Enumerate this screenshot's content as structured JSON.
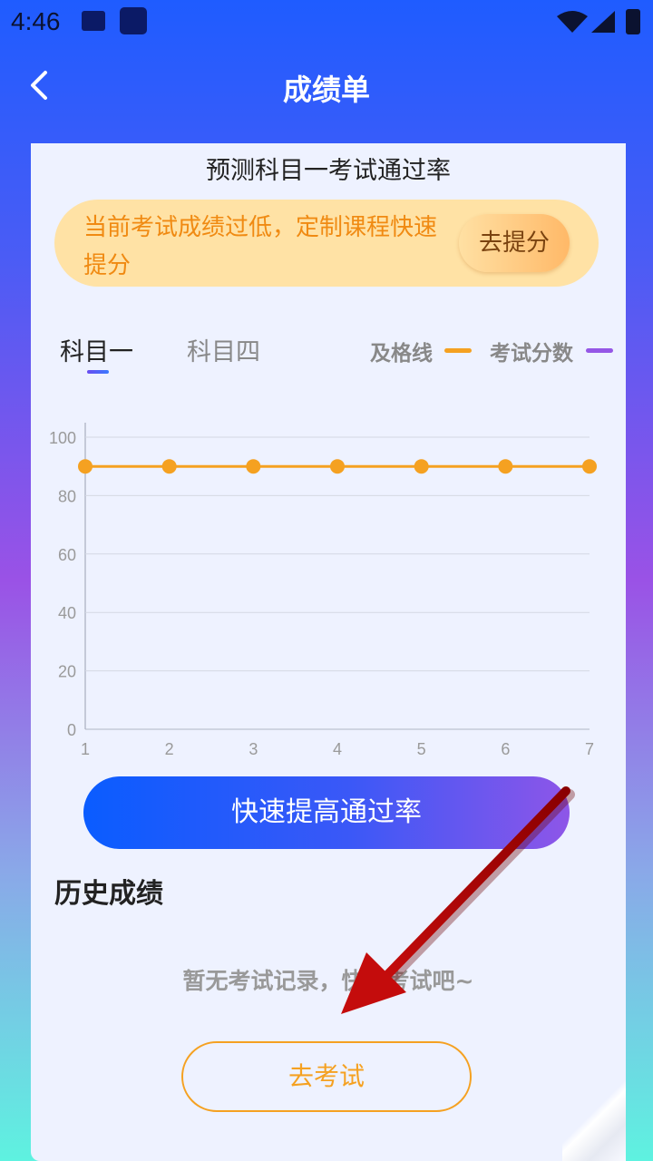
{
  "status": {
    "time": "4:46"
  },
  "nav": {
    "title": "成绩单"
  },
  "card": {
    "title": "预测科目一考试通过率",
    "banner": {
      "text": "当前考试成绩过低，定制课程快速提分",
      "button": "去提分"
    },
    "tabs": [
      "科目一",
      "科目四"
    ],
    "legend": {
      "pass": "及格线",
      "score": "考试分数"
    },
    "cta": "快速提高通过率",
    "history_title": "历史成绩",
    "empty_text": "暂无考试记录，快去考试吧~",
    "exam_button": "去考试"
  },
  "colors": {
    "pass_line": "#f5a121",
    "score_line": "#9557e6",
    "accent_blue": "#0a5cff"
  },
  "chart_data": {
    "type": "line",
    "x": [
      1,
      2,
      3,
      4,
      5,
      6,
      7
    ],
    "y_ticks": [
      0,
      20,
      40,
      60,
      80,
      100
    ],
    "ylim": [
      0,
      100
    ],
    "grid": true,
    "series": [
      {
        "name": "及格线",
        "values": [
          90,
          90,
          90,
          90,
          90,
          90,
          90
        ],
        "color": "#f5a121"
      },
      {
        "name": "考试分数",
        "values": [],
        "color": "#9557e6"
      }
    ]
  }
}
